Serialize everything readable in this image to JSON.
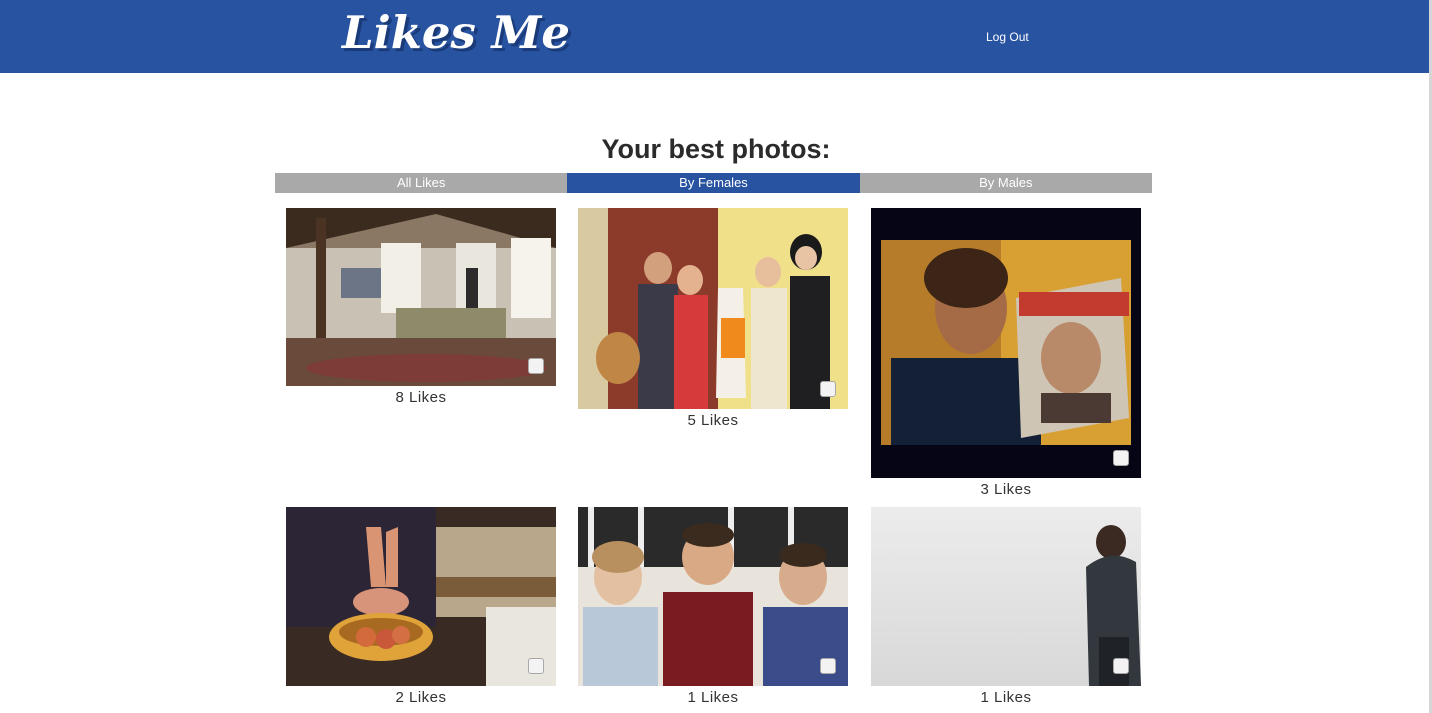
{
  "header": {
    "logo": "Likes Me",
    "logout_label": "Log Out"
  },
  "main": {
    "title": "Your best photos:",
    "tabs": [
      {
        "label": "All Likes",
        "active": false
      },
      {
        "label": "By Females",
        "active": true
      },
      {
        "label": "By Males",
        "active": false
      }
    ],
    "photos": [
      {
        "likes_label": "8 Likes"
      },
      {
        "likes_label": "5 Likes"
      },
      {
        "likes_label": "3 Likes"
      },
      {
        "likes_label": "2 Likes"
      },
      {
        "likes_label": "1 Likes"
      },
      {
        "likes_label": "1 Likes"
      }
    ]
  },
  "colors": {
    "brand": "#2853a1",
    "tab_inactive": "#a9a9a9"
  }
}
